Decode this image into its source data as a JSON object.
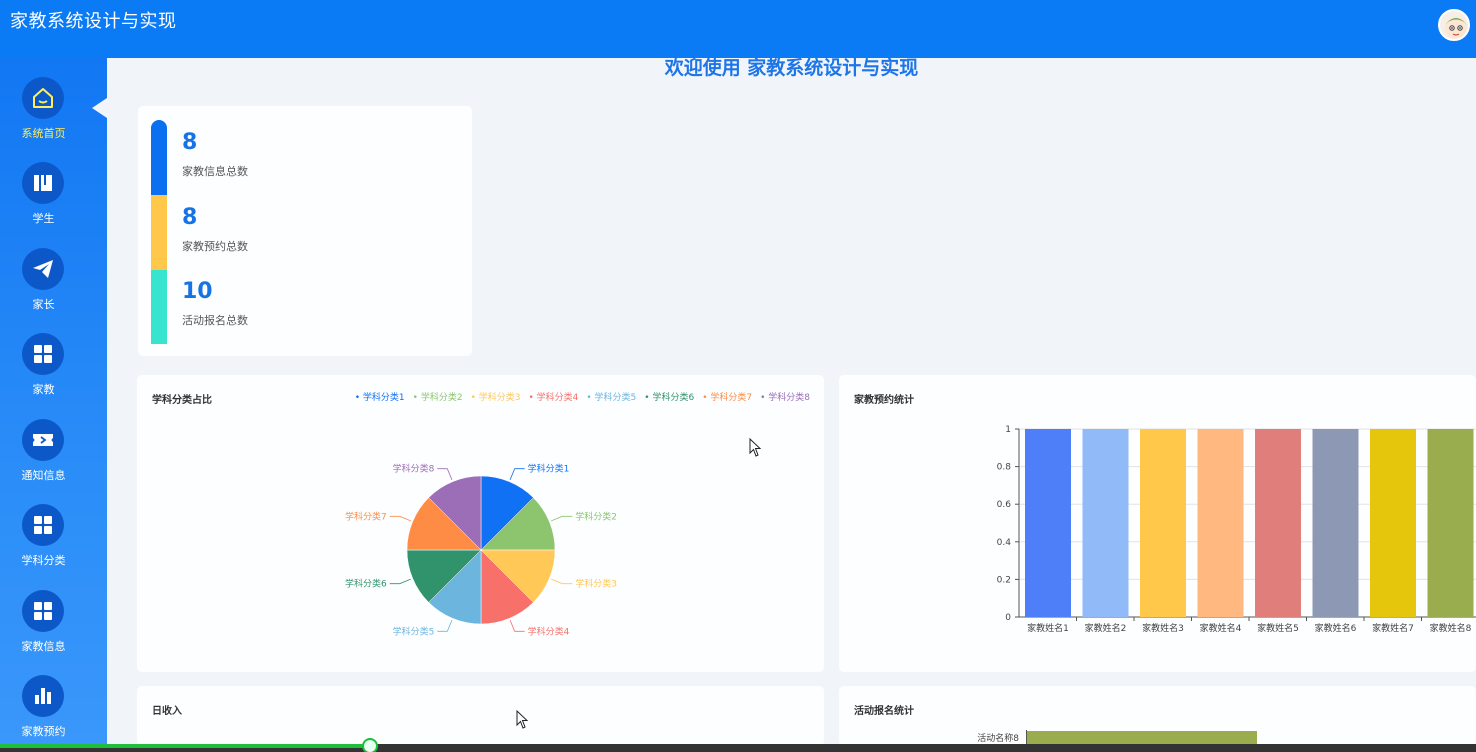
{
  "header": {
    "title": "家教系统设计与实现"
  },
  "sidebar": {
    "items": [
      {
        "label": "系统首页",
        "icon": "home-icon",
        "active": true
      },
      {
        "label": "学生",
        "icon": "book-icon"
      },
      {
        "label": "家长",
        "icon": "paper-plane-icon"
      },
      {
        "label": "家教",
        "icon": "grid-icon"
      },
      {
        "label": "通知信息",
        "icon": "ticket-icon"
      },
      {
        "label": "学科分类",
        "icon": "grid-icon"
      },
      {
        "label": "家教信息",
        "icon": "grid-icon"
      },
      {
        "label": "家教预约",
        "icon": "bar-chart-icon"
      }
    ]
  },
  "welcome": "欢迎使用 家教系统设计与实现",
  "stats": [
    {
      "value": "8",
      "label": "家教信息总数",
      "color": "#0a6ff0"
    },
    {
      "value": "8",
      "label": "家教预约总数",
      "color": "#ffc84a"
    },
    {
      "value": "10",
      "label": "活动报名总数",
      "color": "#36e4d0"
    }
  ],
  "pie": {
    "title": "学科分类占比",
    "chart_data": {
      "type": "pie",
      "labels": [
        "学科分类1",
        "学科分类2",
        "学科分类3",
        "学科分类4",
        "学科分类5",
        "学科分类6",
        "学科分类7",
        "学科分类8"
      ],
      "values": [
        1,
        1,
        1,
        1,
        1,
        1,
        1,
        1
      ],
      "colors": [
        "#1171f5",
        "#8cc56e",
        "#ffc857",
        "#f7716a",
        "#6cb5df",
        "#31936b",
        "#ff8c45",
        "#9c6eb8"
      ],
      "legend": "top-right"
    }
  },
  "bar": {
    "title": "家教预约统计",
    "chart_data": {
      "type": "bar",
      "categories": [
        "家教姓名1",
        "家教姓名2",
        "家教姓名3",
        "家教姓名4",
        "家教姓名5",
        "家教姓名6",
        "家教姓名7",
        "家教姓名8"
      ],
      "values": [
        1,
        1,
        1,
        1,
        1,
        1,
        1,
        1
      ],
      "colors": [
        "#4e7ef8",
        "#91baf8",
        "#ffc84a",
        "#ffb980",
        "#e07e7c",
        "#8c98b4",
        "#e5c60c",
        "#99ad4e"
      ],
      "ylim": [
        0,
        1
      ],
      "yticks": [
        "0",
        "0.2",
        "0.4",
        "0.6",
        "0.8",
        "1"
      ]
    }
  },
  "income": {
    "title": "日收入"
  },
  "activity": {
    "title": "活动报名统计",
    "first_row": "活动名称8"
  }
}
